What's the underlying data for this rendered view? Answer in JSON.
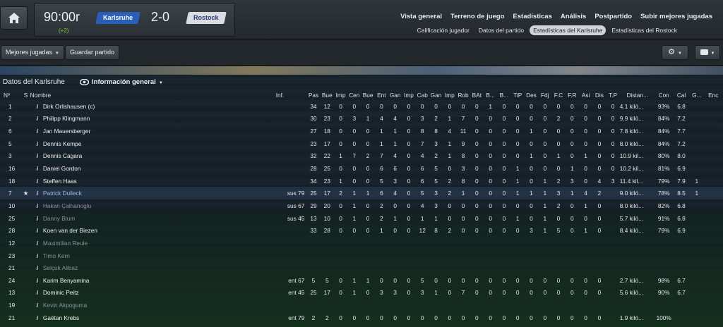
{
  "header": {
    "match_time": "90:00r",
    "added_time": "(+2)",
    "home_team": "Karlsruhe",
    "away_team": "Rostock",
    "score": "2-0",
    "nav_main": [
      "Vista general",
      "Terreno de juego",
      "Estadísticas",
      "Análisis",
      "Postpartido",
      "Subir mejores jugadas"
    ],
    "nav_sub": [
      "Calificación jugador",
      "Datos del partido",
      "Estadísticas del Karlsruhe",
      "Estadísticas del Rostock"
    ],
    "nav_sub_active": 2
  },
  "toolbar": {
    "best_plays": "Mejores jugadas",
    "save_match": "Guardar partido",
    "settings_icon": "gear-icon",
    "chat_icon": "chat-icon"
  },
  "panel": {
    "title": "Datos del Karlsruhe",
    "view_selector": "Información general"
  },
  "colors": {
    "home": "#2a5fb8",
    "away": "#d9dde2",
    "rating_yellow": "#e0d63a",
    "rating_green": "#8bc34a"
  },
  "table": {
    "columns": [
      "Nº",
      "S",
      "Nombre",
      "Inf.",
      "Pas",
      "Bue",
      "Imp",
      "Cen",
      "Bue",
      "Ent",
      "Gan",
      "Imp",
      "Cab",
      "Gan",
      "Imp",
      "Rob",
      "BAt",
      "B...",
      "B...",
      "TiP",
      "Des",
      "Fdj",
      "F.C",
      "F.R",
      "Asi",
      "Dis",
      "T.P",
      "Distan...",
      "Con",
      "Cal",
      "G...",
      "Enc"
    ],
    "rows": [
      {
        "num": "1",
        "star": "",
        "name": "Dirk Orlishausen (c)",
        "dim": false,
        "sub": "",
        "s": [
          "34",
          "12",
          "0",
          "0",
          "0",
          "0",
          "0",
          "0",
          "0",
          "0",
          "0",
          "0",
          "0",
          "1",
          "0",
          "0",
          "0",
          "0",
          "0",
          "0",
          "0",
          "0",
          "0"
        ],
        "dist": "4.1 kiló...",
        "con": "93%",
        "cal": "6.8",
        "calc": "y",
        "g": "",
        "enc": ""
      },
      {
        "num": "2",
        "star": "",
        "name": "Philipp Klingmann",
        "dim": false,
        "sub": "",
        "s": [
          "30",
          "23",
          "0",
          "3",
          "1",
          "4",
          "4",
          "0",
          "3",
          "2",
          "1",
          "7",
          "0",
          "0",
          "0",
          "0",
          "0",
          "0",
          "2",
          "0",
          "0",
          "0",
          "0"
        ],
        "dist": "9.9 kiló...",
        "con": "84%",
        "cal": "7.2",
        "calc": "g",
        "g": "",
        "enc": ""
      },
      {
        "num": "6",
        "star": "",
        "name": "Jan Mauersberger",
        "dim": false,
        "sub": "",
        "s": [
          "27",
          "18",
          "0",
          "0",
          "0",
          "1",
          "1",
          "0",
          "8",
          "8",
          "4",
          "11",
          "0",
          "0",
          "0",
          "0",
          "1",
          "0",
          "0",
          "0",
          "0",
          "0",
          "0"
        ],
        "dist": "7.8 kiló...",
        "con": "84%",
        "cal": "7.7",
        "calc": "g",
        "g": "",
        "enc": ""
      },
      {
        "num": "5",
        "star": "",
        "name": "Dennis Kempe",
        "dim": false,
        "sub": "",
        "s": [
          "23",
          "17",
          "0",
          "0",
          "0",
          "1",
          "1",
          "0",
          "7",
          "3",
          "1",
          "9",
          "0",
          "0",
          "0",
          "0",
          "0",
          "0",
          "0",
          "0",
          "0",
          "0",
          "0"
        ],
        "dist": "8.0 kiló...",
        "con": "84%",
        "cal": "7.2",
        "calc": "g",
        "g": "",
        "enc": ""
      },
      {
        "num": "3",
        "star": "",
        "name": "Dennis Cagara",
        "dim": false,
        "sub": "",
        "s": [
          "32",
          "22",
          "1",
          "7",
          "2",
          "7",
          "4",
          "0",
          "4",
          "2",
          "1",
          "8",
          "0",
          "0",
          "0",
          "0",
          "1",
          "0",
          "1",
          "0",
          "1",
          "0",
          "0"
        ],
        "dist": "10.9 kil...",
        "con": "80%",
        "cal": "8.0",
        "calc": "g",
        "g": "",
        "enc": ""
      },
      {
        "num": "16",
        "star": "",
        "name": "Daniel Gordon",
        "dim": false,
        "sub": "",
        "s": [
          "28",
          "25",
          "0",
          "0",
          "0",
          "6",
          "6",
          "0",
          "6",
          "5",
          "0",
          "3",
          "0",
          "0",
          "0",
          "1",
          "0",
          "0",
          "0",
          "1",
          "0",
          "0",
          "0"
        ],
        "dist": "10.2 kil...",
        "con": "81%",
        "cal": "6.9",
        "calc": "y",
        "g": "",
        "enc": ""
      },
      {
        "num": "18",
        "star": "",
        "name": "Steffen Haas",
        "dim": false,
        "sub": "",
        "s": [
          "34",
          "23",
          "1",
          "0",
          "0",
          "5",
          "3",
          "0",
          "6",
          "5",
          "2",
          "8",
          "0",
          "0",
          "0",
          "1",
          "0",
          "1",
          "2",
          "3",
          "0",
          "4",
          "3"
        ],
        "dist": "11.4 kil...",
        "con": "79%",
        "cal": "7.9",
        "calc": "g",
        "g": "1",
        "enc": ""
      },
      {
        "num": "7",
        "star": "★",
        "name": "Patrick Dulleck",
        "dim": false,
        "sub": "sus 79",
        "s": [
          "25",
          "17",
          "2",
          "1",
          "1",
          "6",
          "4",
          "0",
          "5",
          "3",
          "2",
          "1",
          "0",
          "0",
          "0",
          "1",
          "1",
          "1",
          "3",
          "1",
          "4",
          "2",
          ""
        ],
        "dist": "9.0 kiló...",
        "con": "78%",
        "cal": "8.5",
        "calc": "g",
        "g": "1",
        "enc": ""
      },
      {
        "num": "10",
        "star": "",
        "name": "Hakan Çalhanoglu",
        "dim": true,
        "sub": "sus 67",
        "s": [
          "29",
          "20",
          "0",
          "1",
          "0",
          "2",
          "0",
          "0",
          "4",
          "3",
          "0",
          "0",
          "0",
          "0",
          "0",
          "0",
          "0",
          "1",
          "2",
          "0",
          "1",
          "0",
          ""
        ],
        "dist": "8.0 kiló...",
        "con": "82%",
        "cal": "6.8",
        "calc": "y",
        "g": "",
        "enc": ""
      },
      {
        "num": "25",
        "star": "",
        "name": "Danny Blum",
        "dim": true,
        "sub": "sus 45",
        "s": [
          "13",
          "10",
          "0",
          "1",
          "0",
          "2",
          "1",
          "0",
          "1",
          "1",
          "0",
          "0",
          "0",
          "0",
          "0",
          "1",
          "0",
          "1",
          "0",
          "0",
          "0",
          "0",
          ""
        ],
        "dist": "5.7 kiló...",
        "con": "91%",
        "cal": "6.8",
        "calc": "y",
        "g": "",
        "enc": ""
      },
      {
        "num": "28",
        "star": "",
        "name": "Koen van der Biezen",
        "dim": false,
        "sub": "",
        "s": [
          "33",
          "28",
          "0",
          "0",
          "0",
          "1",
          "0",
          "0",
          "12",
          "8",
          "2",
          "0",
          "0",
          "0",
          "0",
          "0",
          "3",
          "1",
          "5",
          "0",
          "1",
          "0",
          ""
        ],
        "dist": "8.4 kiló...",
        "con": "79%",
        "cal": "6.9",
        "calc": "y",
        "g": "",
        "enc": ""
      },
      {
        "num": "12",
        "star": "",
        "name": "Maximilian Reule",
        "dim": true,
        "sub": "",
        "s": [],
        "dist": "",
        "con": "",
        "cal": "",
        "calc": "y",
        "g": "",
        "enc": ""
      },
      {
        "num": "23",
        "star": "",
        "name": "Timo Kern",
        "dim": true,
        "sub": "",
        "s": [],
        "dist": "",
        "con": "",
        "cal": "",
        "calc": "y",
        "g": "",
        "enc": ""
      },
      {
        "num": "21",
        "star": "",
        "name": "Selçuk Alibaz",
        "dim": true,
        "sub": "",
        "s": [],
        "dist": "",
        "con": "",
        "cal": "",
        "calc": "y",
        "g": "",
        "enc": ""
      },
      {
        "num": "24",
        "star": "",
        "name": "Karim Benyamina",
        "dim": false,
        "sub": "ent 67",
        "s": [
          "5",
          "5",
          "0",
          "1",
          "1",
          "0",
          "0",
          "0",
          "5",
          "0",
          "0",
          "0",
          "0",
          "0",
          "0",
          "0",
          "0",
          "0",
          "0",
          "0",
          "0",
          "0",
          ""
        ],
        "dist": "2.7 kiló...",
        "con": "98%",
        "cal": "6.7",
        "calc": "y",
        "g": "",
        "enc": ""
      },
      {
        "num": "13",
        "star": "",
        "name": "Dominic Peitz",
        "dim": false,
        "sub": "ent 45",
        "s": [
          "25",
          "17",
          "0",
          "1",
          "0",
          "3",
          "3",
          "0",
          "3",
          "1",
          "0",
          "7",
          "0",
          "0",
          "0",
          "0",
          "0",
          "0",
          "0",
          "0",
          "0",
          "0",
          ""
        ],
        "dist": "5.6 kiló...",
        "con": "90%",
        "cal": "6.7",
        "calc": "y",
        "g": "",
        "enc": ""
      },
      {
        "num": "19",
        "star": "",
        "name": "Kevin Akpoguma",
        "dim": true,
        "sub": "",
        "s": [],
        "dist": "",
        "con": "",
        "cal": "",
        "calc": "y",
        "g": "",
        "enc": ""
      },
      {
        "num": "21",
        "star": "",
        "name": "Gaëtan Krebs",
        "dim": false,
        "sub": "ent 79",
        "s": [
          "2",
          "2",
          "0",
          "0",
          "0",
          "0",
          "0",
          "0",
          "0",
          "0",
          "0",
          "0",
          "0",
          "0",
          "0",
          "0",
          "0",
          "0",
          "0",
          "0",
          "0",
          "0",
          ""
        ],
        "dist": "1.9 kiló...",
        "con": "100%",
        "cal": "",
        "calc": "y",
        "g": "",
        "enc": ""
      }
    ]
  }
}
